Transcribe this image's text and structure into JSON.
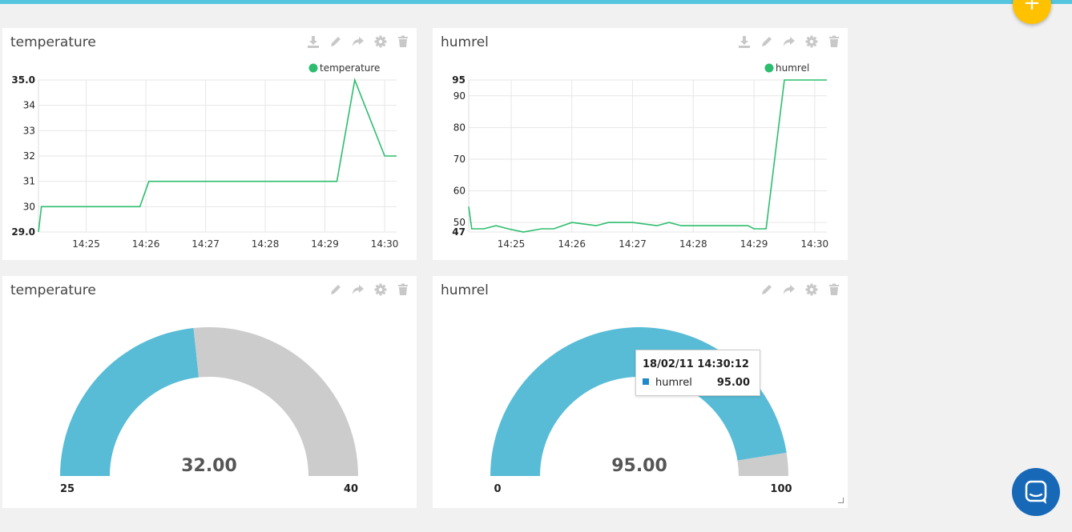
{
  "colors": {
    "topbar": "#55c5de",
    "fab": "#ffc100",
    "line": "#2dbd6e",
    "gauge_fill": "#58bcd6",
    "gauge_rest": "#cccccc",
    "chat": "#1769b8"
  },
  "fab": {
    "label": "+"
  },
  "icons": {
    "download": "download-icon",
    "edit": "pencil-icon",
    "share": "share-icon",
    "settings": "gear-icon",
    "delete": "trash-icon"
  },
  "widgets": {
    "temp_chart": {
      "title": "temperature"
    },
    "hum_chart": {
      "title": "humrel"
    },
    "temp_gauge": {
      "title": "temperature"
    },
    "hum_gauge": {
      "title": "humrel"
    }
  },
  "tooltip": {
    "time": "18/02/11 14:30:12",
    "series": "humrel",
    "value": "95.00"
  },
  "chart_data": [
    {
      "type": "line",
      "legend": "temperature",
      "legend_position": "top-right",
      "x_ticks": [
        "14:25",
        "14:26",
        "14:27",
        "14:28",
        "14:29",
        "14:30"
      ],
      "y_ticks": [
        "29.0",
        "30",
        "31",
        "32",
        "33",
        "34",
        "35.0"
      ],
      "ylim": [
        29,
        35
      ],
      "xlim": [
        "14:24.2",
        "14:30.2"
      ],
      "grid": true,
      "series": [
        {
          "name": "temperature",
          "x": [
            "14:24.2",
            "14:24.25",
            "14:25.9",
            "14:26.05",
            "14:29.2",
            "14:29.5",
            "14:30",
            "14:30.2"
          ],
          "y": [
            29,
            30,
            30,
            31,
            31,
            35,
            32,
            32
          ]
        }
      ]
    },
    {
      "type": "line",
      "legend": "humrel",
      "legend_position": "top-right",
      "x_ticks": [
        "14:25",
        "14:26",
        "14:27",
        "14:28",
        "14:29",
        "14:30"
      ],
      "y_ticks": [
        "47",
        "50",
        "60",
        "70",
        "80",
        "90",
        "95"
      ],
      "ylim": [
        47,
        95
      ],
      "xlim": [
        "14:24.3",
        "14:30.2"
      ],
      "grid": true,
      "series": [
        {
          "name": "humrel",
          "x": [
            "14:24.3",
            "14:24.35",
            "14:24.55",
            "14:24.75",
            "14:24.95",
            "14:25.2",
            "14:25.5",
            "14:25.7",
            "14:26",
            "14:26.2",
            "14:26.4",
            "14:26.6",
            "14:27",
            "14:27.4",
            "14:27.6",
            "14:27.8",
            "14:28.4",
            "14:28.9",
            "14:29",
            "14:29.2",
            "14:29.5",
            "14:30.2"
          ],
          "y": [
            55,
            48,
            48,
            49,
            48,
            47,
            48,
            48,
            50,
            49.5,
            49,
            50,
            50,
            49,
            50,
            49,
            49,
            49,
            48,
            48,
            95,
            95
          ]
        }
      ]
    },
    {
      "type": "gauge",
      "value": 32.0,
      "min": 25,
      "max": 40,
      "value_label": "32.00",
      "min_label": "25",
      "max_label": "40"
    },
    {
      "type": "gauge",
      "value": 95.0,
      "min": 0,
      "max": 100,
      "value_label": "95.00",
      "min_label": "0",
      "max_label": "100"
    }
  ]
}
